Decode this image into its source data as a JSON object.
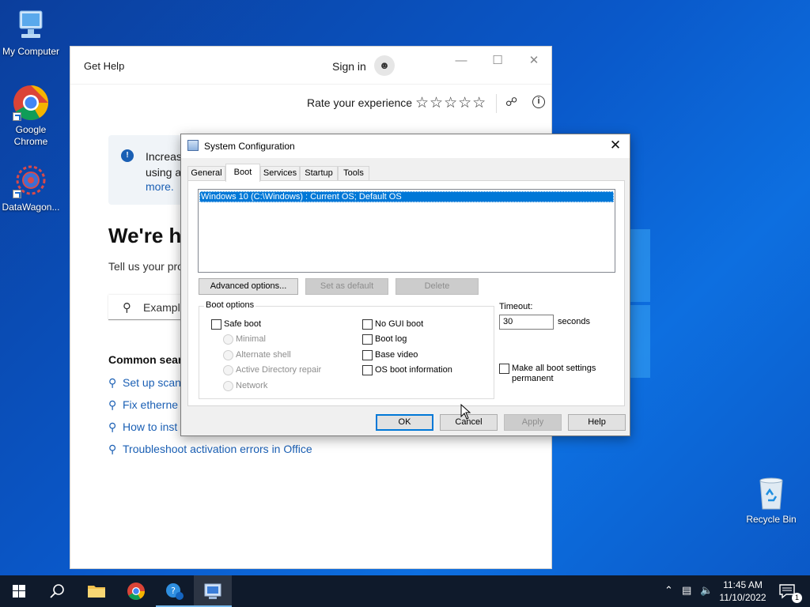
{
  "desktop": {
    "icons": [
      {
        "label": "My Computer",
        "icon": "computer-icon"
      },
      {
        "label": "Google\nChrome",
        "icon": "chrome-icon"
      },
      {
        "label": "DataWagon...",
        "icon": "datawagon-icon"
      },
      {
        "label": "Recycle Bin",
        "icon": "recycle-bin-icon"
      }
    ]
  },
  "get_help": {
    "title": "Get Help",
    "sign_in": "Sign in",
    "controls": {
      "minimize": "—",
      "maximize": "☐",
      "close": "✕"
    },
    "rate_label": "Rate your experience",
    "stars": "☆☆☆☆☆",
    "banner": {
      "text": "Increas\nusing a",
      "more": "more."
    },
    "heading": "We're h",
    "subheading": "Tell us your pro",
    "search_placeholder": "Example",
    "common_heading": "Common searc",
    "links": [
      "Set up scan",
      "Fix etherne",
      "How to inst",
      "Troubleshoot activation errors in Office"
    ]
  },
  "msconfig": {
    "title": "System Configuration",
    "close": "✕",
    "tabs": [
      "General",
      "Boot",
      "Services",
      "Startup",
      "Tools"
    ],
    "active_tab": "Boot",
    "os_entries": [
      "Windows 10 (C:\\Windows) : Current OS; Default OS"
    ],
    "buttons": {
      "advanced": "Advanced options...",
      "set_default": "Set as default",
      "delete": "Delete",
      "ok": "OK",
      "cancel": "Cancel",
      "apply": "Apply",
      "help": "Help"
    },
    "boot_options": {
      "label": "Boot options",
      "safe_boot": "Safe boot",
      "minimal": "Minimal",
      "alternate_shell": "Alternate shell",
      "active_directory": "Active Directory repair",
      "network": "Network",
      "no_gui_boot": "No GUI boot",
      "boot_log": "Boot log",
      "base_video": "Base video",
      "os_boot_info": "OS boot information"
    },
    "timeout": {
      "label": "Timeout:",
      "value": "30",
      "unit": "seconds"
    },
    "make_permanent": "Make all boot settings permanent"
  },
  "taskbar": {
    "clock_time": "11:45 AM",
    "clock_date": "11/10/2022",
    "notification_count": "1"
  }
}
